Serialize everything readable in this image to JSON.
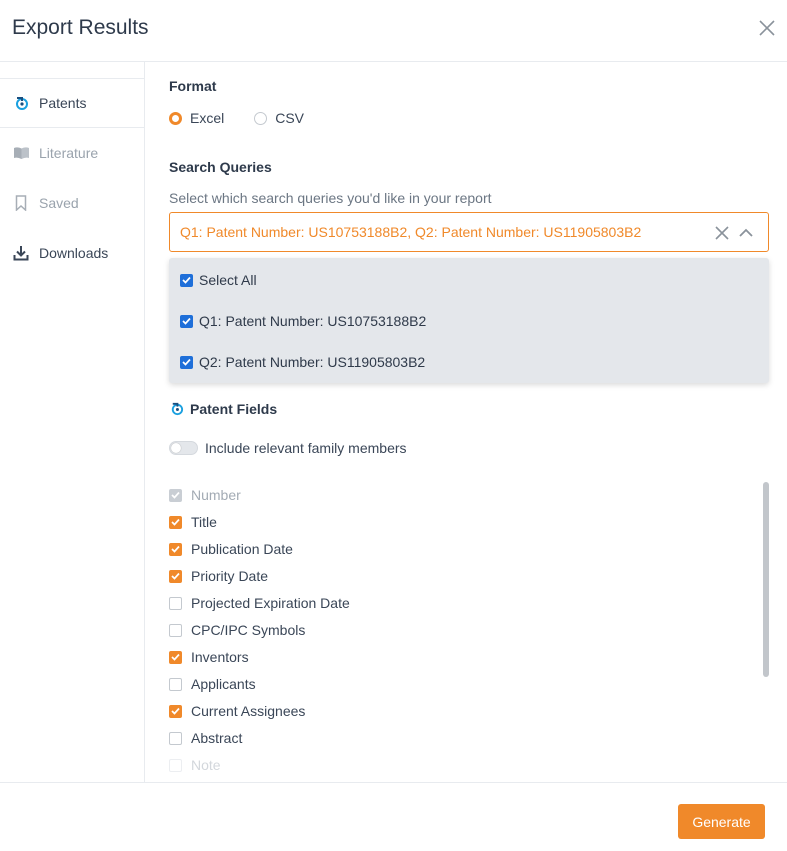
{
  "dialog": {
    "title": "Export Results"
  },
  "sidebar": {
    "items": [
      {
        "label": "Patents",
        "icon": "patent-icon",
        "active": true
      },
      {
        "label": "Literature",
        "icon": "book-icon",
        "active": false
      },
      {
        "label": "Saved",
        "icon": "bookmark-icon",
        "active": false
      },
      {
        "label": "Downloads",
        "icon": "download-icon",
        "active": false
      }
    ]
  },
  "format": {
    "label": "Format",
    "options": [
      {
        "label": "Excel",
        "checked": true
      },
      {
        "label": "CSV",
        "checked": false
      }
    ]
  },
  "search_queries": {
    "label": "Search Queries",
    "hint": "Select which search queries you'd like in your report",
    "selected_value": "Q1: Patent Number: US10753188B2, Q2: Patent Number: US11905803B2",
    "dropdown": {
      "options": [
        {
          "label": "Select All",
          "checked": true
        },
        {
          "label": "Q1: Patent Number: US10753188B2",
          "checked": true
        },
        {
          "label": "Q2: Patent Number: US11905803B2",
          "checked": true
        }
      ]
    }
  },
  "patent_fields": {
    "label": "Patent Fields",
    "family_toggle_label": "Include relevant family members",
    "family_toggle_on": false,
    "fields": [
      {
        "label": "Number",
        "checked": true,
        "disabled": true
      },
      {
        "label": "Title",
        "checked": true
      },
      {
        "label": "Publication Date",
        "checked": true
      },
      {
        "label": "Priority Date",
        "checked": true
      },
      {
        "label": "Projected Expiration Date",
        "checked": false
      },
      {
        "label": "CPC/IPC Symbols",
        "checked": false
      },
      {
        "label": "Inventors",
        "checked": true
      },
      {
        "label": "Applicants",
        "checked": false
      },
      {
        "label": "Current Assignees",
        "checked": true
      },
      {
        "label": "Abstract",
        "checked": false
      },
      {
        "label": "Note",
        "checked": false
      }
    ]
  },
  "footer": {
    "generate_label": "Generate"
  },
  "colors": {
    "accent": "#f0892a",
    "checkbox_blue": "#1e6fd9",
    "patent_icon_blue": "#1aa0e0"
  }
}
